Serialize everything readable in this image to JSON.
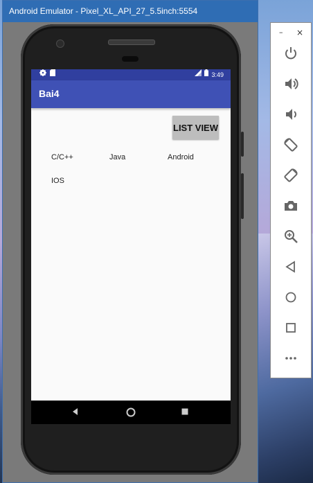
{
  "window": {
    "title": "Android Emulator - Pixel_XL_API_27_5.5inch:5554"
  },
  "status_bar": {
    "time": "3:49"
  },
  "app": {
    "title": "Bai4",
    "button_label": "LIST VIEW",
    "grid_items": [
      "C/C++",
      "Java",
      "Android",
      "IOS"
    ]
  },
  "nav_bar": {
    "icons": [
      "back-icon",
      "home-icon",
      "recents-icon"
    ]
  },
  "control_panel": {
    "minimize": "–",
    "close": "×",
    "buttons": [
      "power",
      "volume-up",
      "volume-down",
      "rotate-left",
      "rotate-right",
      "camera",
      "zoom",
      "back",
      "home",
      "overview",
      "more"
    ]
  },
  "colors": {
    "status_bar": "#303f9f",
    "app_bar": "#3f51b5",
    "title_bar": "#2f6db4"
  }
}
